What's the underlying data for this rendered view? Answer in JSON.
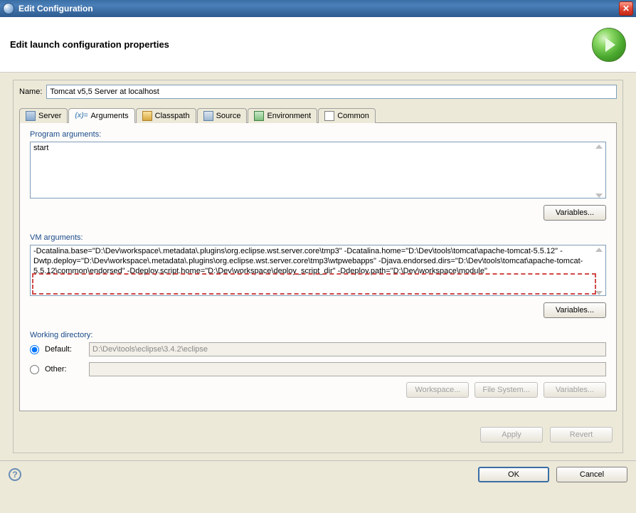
{
  "titlebar": {
    "title": "Edit Configuration"
  },
  "header": {
    "title": "Edit launch configuration properties"
  },
  "form": {
    "name_label": "Name:",
    "name_value": "Tomcat v5,5 Server at localhost"
  },
  "tabs": {
    "server": "Server",
    "arguments": "Arguments",
    "classpath": "Classpath",
    "source": "Source",
    "environment": "Environment",
    "common": "Common"
  },
  "args": {
    "program_label": "Program arguments:",
    "program_value": "start",
    "vm_label": "VM arguments:",
    "vm_value": "-Dcatalina.base=\"D:\\Dev\\workspace\\.metadata\\.plugins\\org.eclipse.wst.server.core\\tmp3\" -Dcatalina.home=\"D:\\Dev\\tools\\tomcat\\apache-tomcat-5.5.12\" -Dwtp.deploy=\"D:\\Dev\\workspace\\.metadata\\.plugins\\org.eclipse.wst.server.core\\tmp3\\wtpwebapps\" -Djava.endorsed.dirs=\"D:\\Dev\\tools\\tomcat\\apache-tomcat-5.5.12\\common\\endorsed\" -Ddeploy.script.home=\"D:\\Dev\\workspace\\deploy_script_dir\" -Ddeploy.path=\"D:\\Dev\\workspace\\module\"",
    "variables_label": "Variables..."
  },
  "wd": {
    "label": "Working directory:",
    "default_label": "Default:",
    "default_value": "D:\\Dev\\tools\\eclipse\\3.4.2\\eclipse",
    "other_label": "Other:",
    "workspace_btn": "Workspace...",
    "filesystem_btn": "File System...",
    "variables_btn": "Variables..."
  },
  "actions": {
    "apply": "Apply",
    "revert": "Revert",
    "ok": "OK",
    "cancel": "Cancel"
  }
}
